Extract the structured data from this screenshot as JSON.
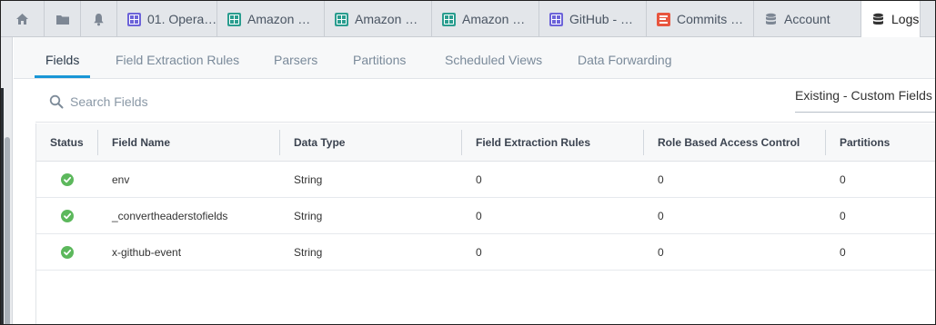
{
  "tabs": [
    {
      "name": "home",
      "icon": "home-icon",
      "label": ""
    },
    {
      "name": "folder",
      "icon": "folder-icon",
      "label": ""
    },
    {
      "name": "alerts",
      "icon": "bell-icon",
      "label": ""
    },
    {
      "name": "operations",
      "icon": "dashboard-icon",
      "label": "01. Opera…"
    },
    {
      "name": "amazon-1",
      "icon": "dashboard-icon",
      "label": "Amazon …"
    },
    {
      "name": "amazon-2",
      "icon": "dashboard-icon",
      "label": "Amazon …"
    },
    {
      "name": "amazon-3",
      "icon": "dashboard-icon",
      "label": "Amazon …"
    },
    {
      "name": "github",
      "icon": "dashboard-icon",
      "label": "GitHub - …"
    },
    {
      "name": "commits",
      "icon": "log-search-icon",
      "label": "Commits …"
    },
    {
      "name": "account",
      "icon": "database-icon",
      "label": "Account"
    },
    {
      "name": "logs",
      "icon": "database-icon",
      "label": "Logs"
    }
  ],
  "subnav": {
    "items": [
      "Fields",
      "Field Extraction Rules",
      "Parsers",
      "Partitions",
      "Scheduled Views",
      "Data Forwarding"
    ],
    "active": "Fields"
  },
  "search": {
    "placeholder": "Search Fields",
    "value": "",
    "icon": "search-icon"
  },
  "filter": {
    "selected": "Existing - Custom Fields"
  },
  "table": {
    "columns": [
      "Status",
      "Field Name",
      "Data Type",
      "Field Extraction Rules",
      "Role Based Access Control",
      "Partitions"
    ],
    "rows": [
      {
        "status": "check-circle-icon",
        "field_name": "env",
        "data_type": "String",
        "fer": "0",
        "rbac": "0",
        "partitions": "0"
      },
      {
        "status": "check-circle-icon",
        "field_name": "_convertheaderstofields",
        "data_type": "String",
        "fer": "0",
        "rbac": "0",
        "partitions": "0"
      },
      {
        "status": "check-circle-icon",
        "field_name": "x-github-event",
        "data_type": "String",
        "fer": "0",
        "rbac": "0",
        "partitions": "0"
      }
    ]
  },
  "colors": {
    "accent": "#1996d6",
    "dashboard_teal": "#2a9d8f",
    "dashboard_purple": "#6c63d9",
    "log_orange": "#e8553e",
    "status_ok": "#5cb85c"
  }
}
